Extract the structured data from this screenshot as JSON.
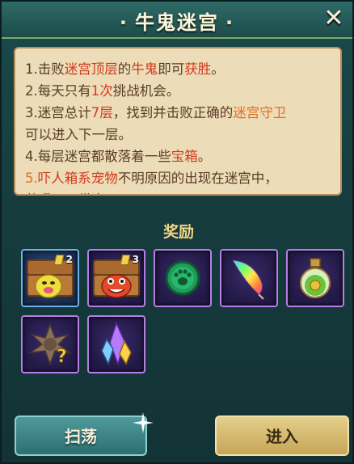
{
  "dialog": {
    "title": "牛鬼迷宫",
    "close_icon": "close-icon"
  },
  "rules": [
    {
      "parts": [
        {
          "t": "1.击败"
        },
        {
          "t": "迷宫顶层",
          "c": "red"
        },
        {
          "t": "的"
        },
        {
          "t": "牛鬼",
          "c": "red"
        },
        {
          "t": "即可"
        },
        {
          "t": "获胜",
          "c": "red"
        },
        {
          "t": "。"
        }
      ]
    },
    {
      "parts": [
        {
          "t": "2.每天只有"
        },
        {
          "t": "1次",
          "c": "red"
        },
        {
          "t": "挑战机会。"
        }
      ]
    },
    {
      "parts": [
        {
          "t": "3.迷宫总计"
        },
        {
          "t": "7层",
          "c": "red"
        },
        {
          "t": "，找到并击败正确的"
        },
        {
          "t": "迷宫守卫",
          "c": "orange"
        }
      ]
    },
    {
      "parts": [
        {
          "t": "可以进入下一层。"
        }
      ]
    },
    {
      "parts": [
        {
          "t": "4.每层迷宫都散落着一些"
        },
        {
          "t": "宝箱",
          "c": "red"
        },
        {
          "t": "。"
        }
      ]
    },
    {
      "parts": [
        {
          "t": "5.",
          "c": "orange"
        },
        {
          "t": "吓人箱系宠物",
          "c": "red"
        },
        {
          "t": "不明原因的出现在迷宫中，"
        }
      ]
    },
    {
      "parts": [
        {
          "t": "若遇见可带走。"
        }
      ]
    }
  ],
  "rewards": {
    "title": "奖励",
    "items": [
      {
        "name": "yellow-pet-chest",
        "rarity": "blue",
        "count": "2"
      },
      {
        "name": "red-pet-chest",
        "rarity": "purple",
        "count": "3"
      },
      {
        "name": "green-paw-coin",
        "rarity": "purple",
        "count": ""
      },
      {
        "name": "rainbow-feather",
        "rarity": "purple",
        "count": ""
      },
      {
        "name": "green-potion-flask",
        "rarity": "purple",
        "count": ""
      },
      {
        "name": "mystery-item",
        "rarity": "purple",
        "count": ""
      },
      {
        "name": "purple-crystals",
        "rarity": "purple",
        "count": ""
      }
    ]
  },
  "buttons": {
    "sweep": "扫荡",
    "enter": "进入"
  },
  "colors": {
    "highlight_red": "#d23a1d",
    "highlight_orange": "#e07020",
    "reward_title": "#f0d580"
  }
}
